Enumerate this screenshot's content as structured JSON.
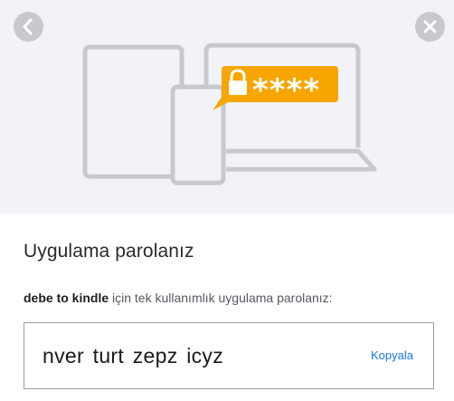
{
  "nav": {
    "back_icon": "chevron-left-icon",
    "close_icon": "close-x-icon"
  },
  "illustration": {
    "description_icons": [
      "tablet-icon",
      "phone-icon",
      "laptop-icon",
      "lock-icon"
    ],
    "password_mask": "****",
    "accent_color": "#f7a600",
    "device_color": "#c7c9cf"
  },
  "title": "Uygulama parolanız",
  "description": {
    "app_name": "debe to kindle",
    "suffix": " için tek kullanımlık uygulama parolanız:"
  },
  "password": {
    "value": "nver turt zepz icyz",
    "copy_label": "Kopyala"
  },
  "colors": {
    "hero_bg": "#f1f3f8",
    "link": "#1a73e8"
  }
}
